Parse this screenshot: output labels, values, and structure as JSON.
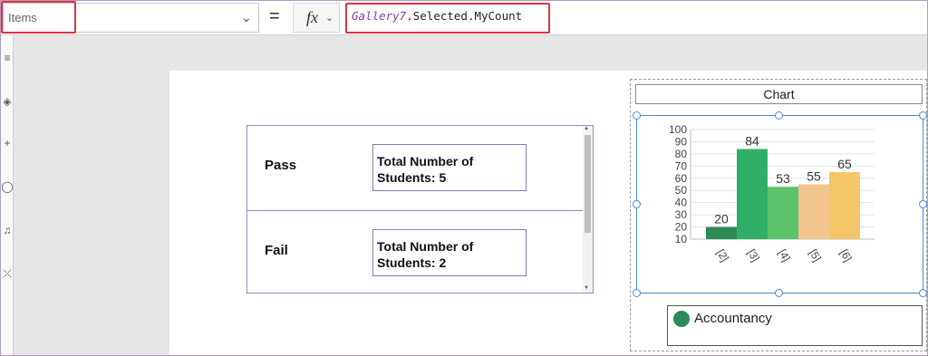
{
  "formula_bar": {
    "property": "Items",
    "fx_label": "fx",
    "equals": "=",
    "formula_control": "Gallery7",
    "formula_rest": ".Selected.MyCount",
    "highlight_color": "#e0323c"
  },
  "gallery": {
    "rows": [
      {
        "title": "Pass",
        "box_line1": "Total Number of",
        "box_line2": "Students: 5"
      },
      {
        "title": "Fail",
        "box_line1": "Total Number of",
        "box_line2": "Students: 2"
      }
    ]
  },
  "chart_title": "Chart",
  "legend": {
    "label": "Accountancy",
    "color": "#2e8b57"
  },
  "chart_data": {
    "type": "bar",
    "categories": [
      "[2]",
      "[3]",
      "[4]",
      "[5]",
      "[6]"
    ],
    "values": [
      20,
      84,
      53,
      55,
      65
    ],
    "colors": [
      "#2e8b57",
      "#2fae68",
      "#5cc46a",
      "#f3c68e",
      "#f5c56a"
    ],
    "yticks": [
      10,
      20,
      30,
      40,
      50,
      60,
      70,
      80,
      90,
      100
    ],
    "ylim": [
      10,
      100
    ],
    "title": "",
    "xlabel": "",
    "ylabel": "",
    "grid": true
  }
}
